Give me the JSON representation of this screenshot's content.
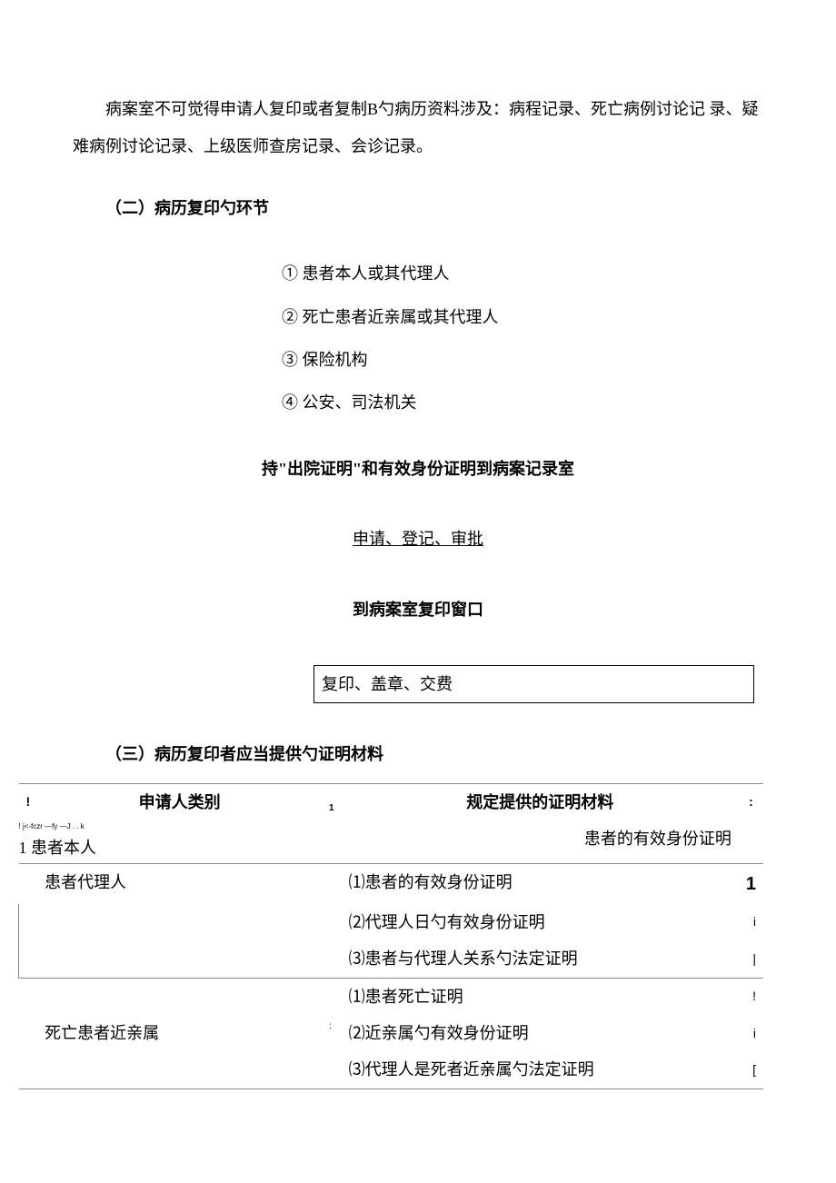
{
  "paragraph1": "病案室不可觉得申请人复印或者复制B勺病历资料涉及：病程记录、死亡病例讨论记 录、疑难病例讨论记录、上级医师查房记录、会诊记录。",
  "section2_header": "（二）病历复印勺环节",
  "list_items": [
    "① 患者本人或其代理人",
    "② 死亡患者近亲属或其代理人",
    "③ 保险机构",
    "④ 公安、司法机关"
  ],
  "flow_step1": "持\"出院证明\"和有效身份证明到病案记录室",
  "flow_step2": "申请、登记、审批",
  "flow_step3": "到病案室复印窗口",
  "flow_step4": "复印、盖章、交费",
  "section3_header": "（三）病历复印者应当提供勺证明材料",
  "table": {
    "header_col1": "申请人类别",
    "header_col2": "规定提供的证明材料",
    "header_edge_left": "!",
    "header_edge_right": ":",
    "row_marker_tiny": "! j<-fczr —fy —J . . k",
    "row_marker_edge": "1",
    "row1_col1": "1 患者本人",
    "row1_col2": "患者的有效身份证明",
    "row2_col1": "患者代理人",
    "row2_items": [
      "⑴患者的有效身份证明",
      "⑵代理人日勺有效身份证明",
      "⑶患者与代理人关系勺法定证明"
    ],
    "row2_edges": [
      "1",
      "i",
      "|"
    ],
    "row3_col1": "死亡患者近亲属",
    "row3_items": [
      "⑴患者死亡证明",
      "⑵近亲属勺有效身份证明",
      "⑶代理人是死者近亲属勺法定证明"
    ],
    "row3_edges": [
      "!",
      "i",
      "["
    ],
    "row3_col1_prefix": ":"
  }
}
